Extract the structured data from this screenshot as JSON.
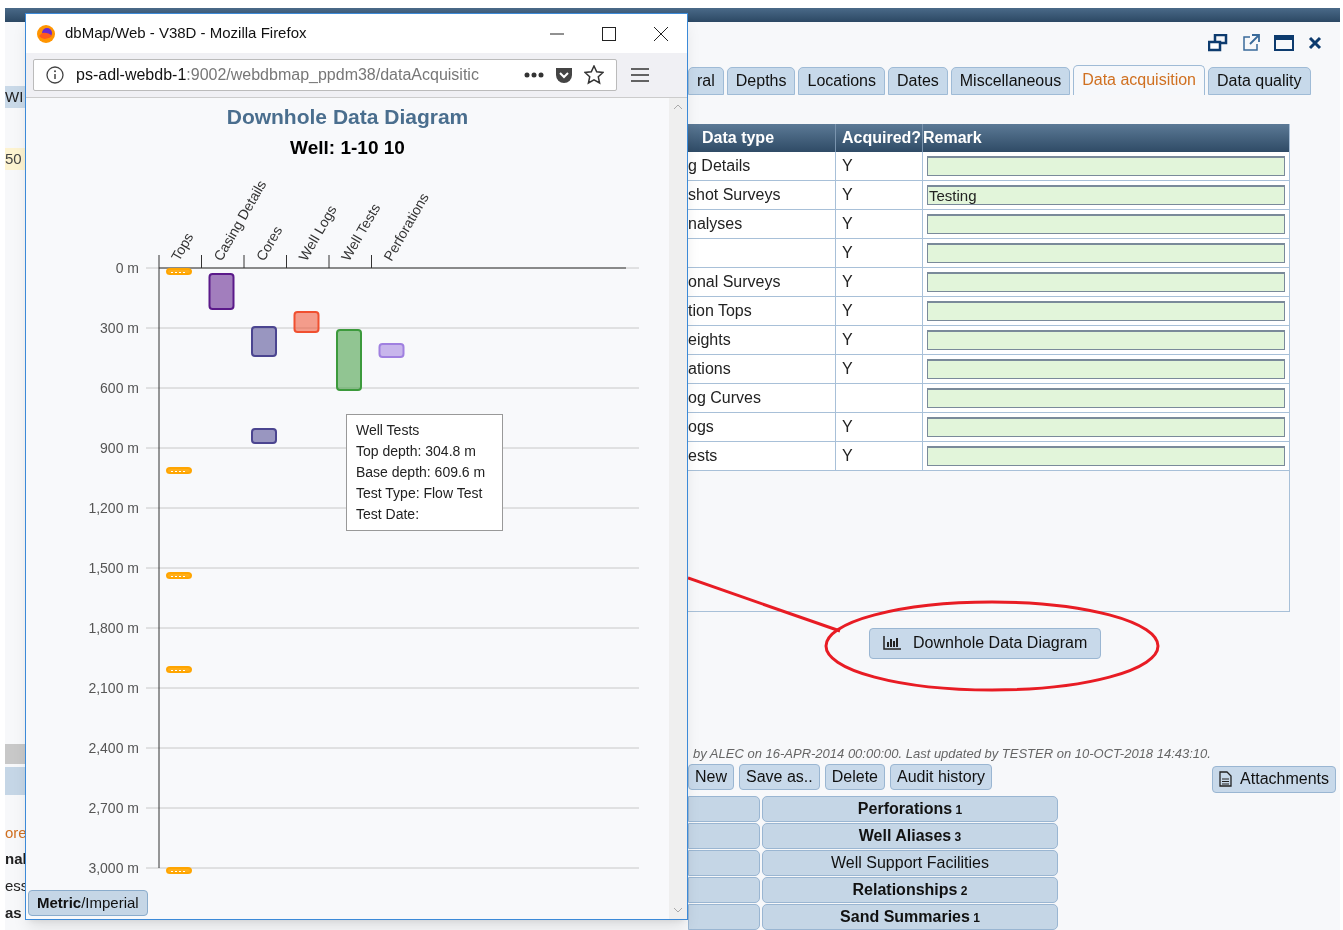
{
  "app": {
    "left_edge": [
      {
        "kind": "tab",
        "text": "WI"
      },
      {
        "kind": "field",
        "text": "50"
      },
      {
        "kind": "link",
        "text": "ore"
      },
      {
        "kind": "bold",
        "text": "nal"
      },
      {
        "kind": "plain",
        "text": "ess"
      },
      {
        "kind": "bold",
        "text": "as"
      }
    ],
    "tabs": [
      {
        "label": "ral",
        "selected": false
      },
      {
        "label": "Depths",
        "selected": false
      },
      {
        "label": "Locations",
        "selected": false
      },
      {
        "label": "Dates",
        "selected": false
      },
      {
        "label": "Miscellaneous",
        "selected": false
      },
      {
        "label": "Data acquisition",
        "selected": true
      },
      {
        "label": "Data quality",
        "selected": false
      }
    ],
    "table": {
      "columns": [
        "Data type",
        "Acquired?",
        "Remark"
      ],
      "rows": [
        {
          "data_type": "g Details",
          "acquired": "Y"
        },
        {
          "data_type": "shot Surveys",
          "acquired": "Y",
          "remark": "Testing"
        },
        {
          "data_type": "nalyses",
          "acquired": "Y"
        },
        {
          "acquired": "Y"
        },
        {
          "data_type": "onal Surveys",
          "acquired": "Y"
        },
        {
          "data_type": "tion Tops",
          "acquired": "Y"
        },
        {
          "data_type": "eights",
          "acquired": "Y"
        },
        {
          "data_type": "ations",
          "acquired": "Y"
        },
        {
          "data_type": "og Curves"
        },
        {
          "data_type": "ogs",
          "acquired": "Y"
        },
        {
          "data_type": "ests",
          "acquired": "Y"
        }
      ]
    },
    "diagram_button": "Downhole Data Diagram",
    "audit_text": "by ALEC on 16-APR-2014 00:00:00. Last updated by TESTER on 10-OCT-2018 14:43:10.",
    "actions": [
      "New",
      "Save as..",
      "Delete",
      "Audit history"
    ],
    "attachments_button": "Attachments",
    "related": [
      {
        "label": "Perforations",
        "count": "1",
        "has_records": true
      },
      {
        "label": "Well Aliases",
        "count": "3",
        "has_records": true
      },
      {
        "label": "Well Support Facilities",
        "has_records": false
      },
      {
        "label": "Relationships",
        "count": "2",
        "has_records": true
      },
      {
        "label": "Sand Summaries",
        "count": "1",
        "has_records": true
      }
    ]
  },
  "popup": {
    "window_title": "dbMap/Web - V38D - Mozilla Firefox",
    "url_host": "ps-adl-webdb-1",
    "url_rest": ":9002/webdbmap_ppdm38/dataAcquisitic",
    "page_title": "Downhole Data Diagram",
    "subtitle": "Well: 1-10 10",
    "diagram": {
      "columns": [
        {
          "label": "Tops",
          "color": "#ffa500"
        },
        {
          "label": "Casing Details",
          "color": "#5b1a8a"
        },
        {
          "label": "Cores",
          "color": "#4b4590"
        },
        {
          "label": "Well Logs",
          "color": "#f05030"
        },
        {
          "label": "Well Tests",
          "color": "#3c9a3c"
        },
        {
          "label": "Perforations",
          "color": "#a080e0"
        }
      ],
      "depth_labels": [
        "0 m",
        "300 m",
        "600 m",
        "900 m",
        "1,200 m",
        "1,500 m",
        "1,800 m",
        "2,100 m",
        "2,400 m",
        "2,700 m",
        "3,000 m"
      ]
    },
    "tooltip": [
      "Well Tests",
      "Top depth: 304.8 m",
      "Base depth: 609.6 m",
      "Test Type: Flow Test",
      "Test Date:"
    ],
    "unit_toggle": "**Metric**/Imperial"
  }
}
